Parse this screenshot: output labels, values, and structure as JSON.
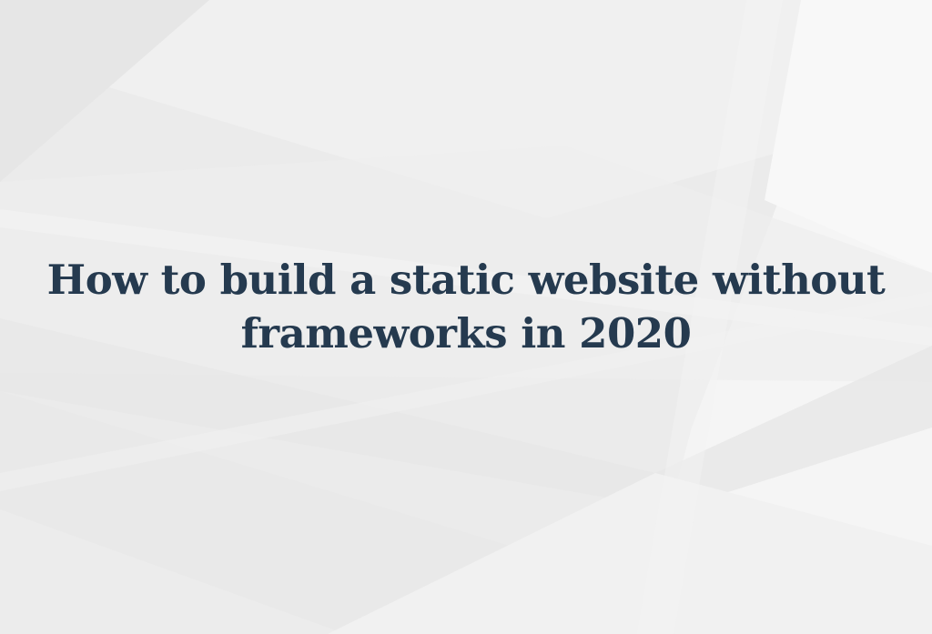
{
  "title": {
    "line1": "How to build a static website without",
    "line2": "frameworks in 2020"
  },
  "colors": {
    "background": "#ebebeb",
    "title_text": "#253a4f"
  }
}
